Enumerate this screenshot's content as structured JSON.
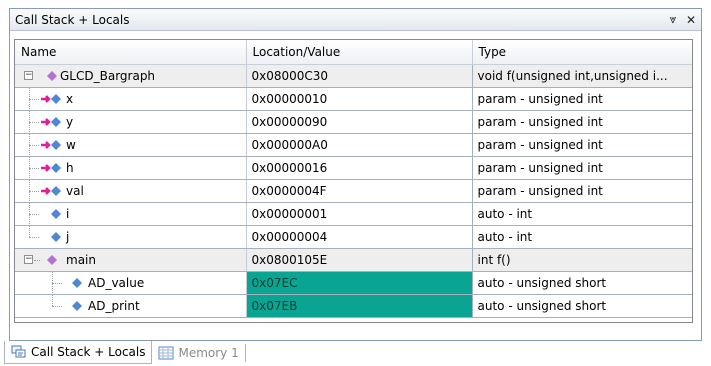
{
  "window": {
    "title": "Call Stack + Locals",
    "pin_glyph": "⩔",
    "close_glyph": "✕"
  },
  "columns": {
    "name": "Name",
    "location": "Location/Value",
    "type": "Type"
  },
  "rows": [
    {
      "name": "GLCD_Bargraph",
      "location": "0x08000C30",
      "type": "void f(unsigned int,unsigned i...",
      "icon": "function-icon"
    },
    {
      "name": "x",
      "location": "0x00000010",
      "type": "param - unsigned int",
      "icon": "param-icon"
    },
    {
      "name": "y",
      "location": "0x00000090",
      "type": "param - unsigned int",
      "icon": "param-icon"
    },
    {
      "name": "w",
      "location": "0x000000A0",
      "type": "param - unsigned int",
      "icon": "param-icon"
    },
    {
      "name": "h",
      "location": "0x00000016",
      "type": "param - unsigned int",
      "icon": "param-icon"
    },
    {
      "name": "val",
      "location": "0x0000004F",
      "type": "param - unsigned int",
      "icon": "param-icon"
    },
    {
      "name": "i",
      "location": "0x00000001",
      "type": "auto - int",
      "icon": "variable-icon"
    },
    {
      "name": "j",
      "location": "0x00000004",
      "type": "auto - int",
      "icon": "variable-icon"
    },
    {
      "name": "main",
      "location": "0x0800105E",
      "type": "int f()",
      "icon": "function-icon"
    },
    {
      "name": "AD_value",
      "location": "0x07EC",
      "type": "auto - unsigned short",
      "icon": "variable-icon"
    },
    {
      "name": "AD_print",
      "location": "0x07EB",
      "type": "auto - unsigned short",
      "icon": "variable-icon"
    }
  ],
  "tabs": [
    {
      "label": "Call Stack + Locals",
      "active": true
    },
    {
      "label": "Memory 1",
      "active": false
    }
  ],
  "colors": {
    "highlight": "#0aa592",
    "group_row": "#eeeeee",
    "param_arrow": "#e0209a",
    "diamond_blue": "#4f86d6",
    "diamond_purple": "#b36fd6"
  }
}
